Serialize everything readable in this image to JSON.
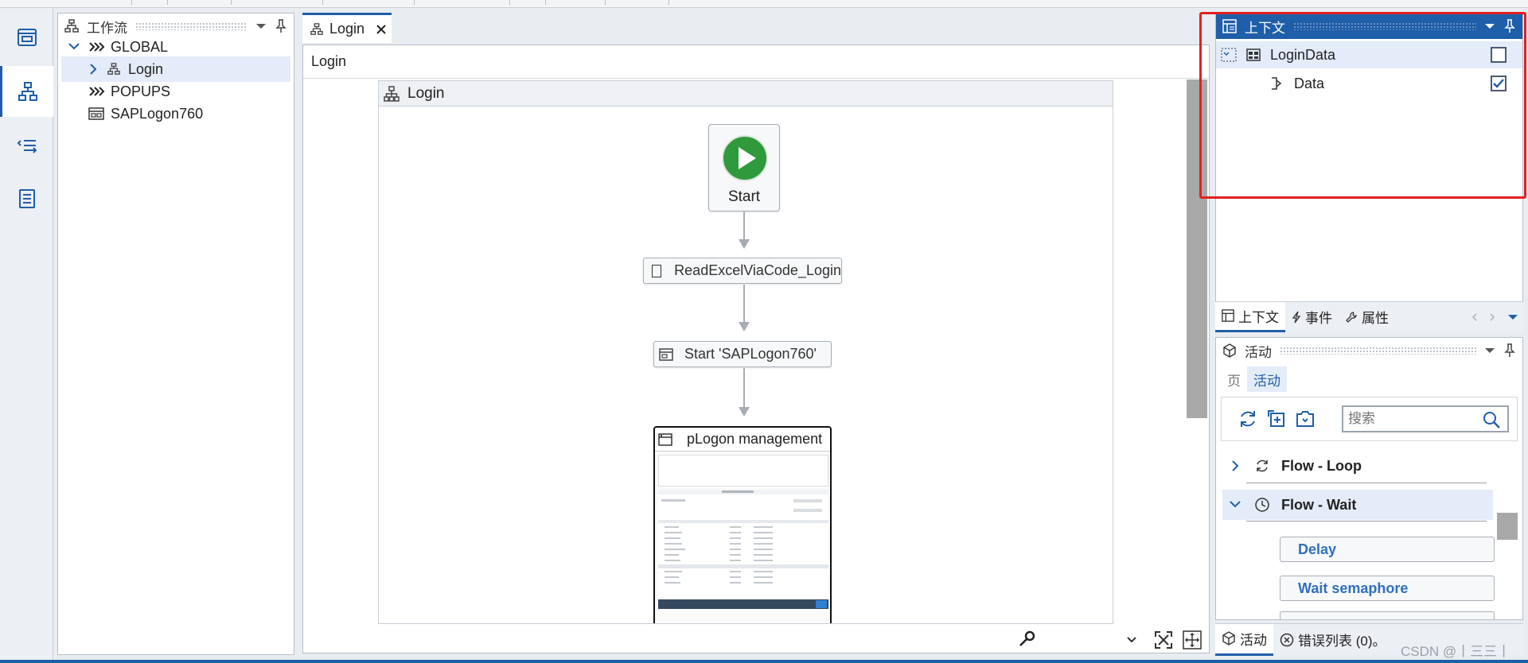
{
  "workflow_panel": {
    "title": "工作流",
    "tree": [
      {
        "label": "GLOBAL"
      },
      {
        "label": "Login"
      },
      {
        "label": "POPUPS"
      },
      {
        "label": "SAPLogon760"
      }
    ]
  },
  "editor": {
    "tab_label": "Login",
    "breadcrumb": "Login",
    "canvas_title": "Login",
    "start_label": "Start",
    "activity1": "ReadExcelViaCode_Login",
    "activity2": "Start 'SAPLogon760'",
    "screen_title": "pLogon management"
  },
  "context_panel": {
    "title": "上下文",
    "items": [
      {
        "label": "LoginData",
        "checked": false
      },
      {
        "label": "Data",
        "checked": true
      }
    ]
  },
  "panel_tabs": [
    "上下文",
    "事件",
    "属性"
  ],
  "activities_panel": {
    "title": "活动",
    "subtabs": [
      "页",
      "活动"
    ],
    "search_placeholder": "搜索",
    "groups": [
      {
        "label": "Flow - Loop",
        "expanded": false
      },
      {
        "label": "Flow - Wait",
        "expanded": true
      }
    ],
    "items": [
      "Delay",
      "Wait semaphore"
    ]
  },
  "bottom_tabs": [
    "活动",
    "错误列表 (0)。"
  ],
  "watermark": "CSDN @丨三三丨",
  "colors": {
    "accent": "#1f5ea8",
    "highlight_box": "#e41f1f",
    "start_green": "#2e9a3c"
  }
}
